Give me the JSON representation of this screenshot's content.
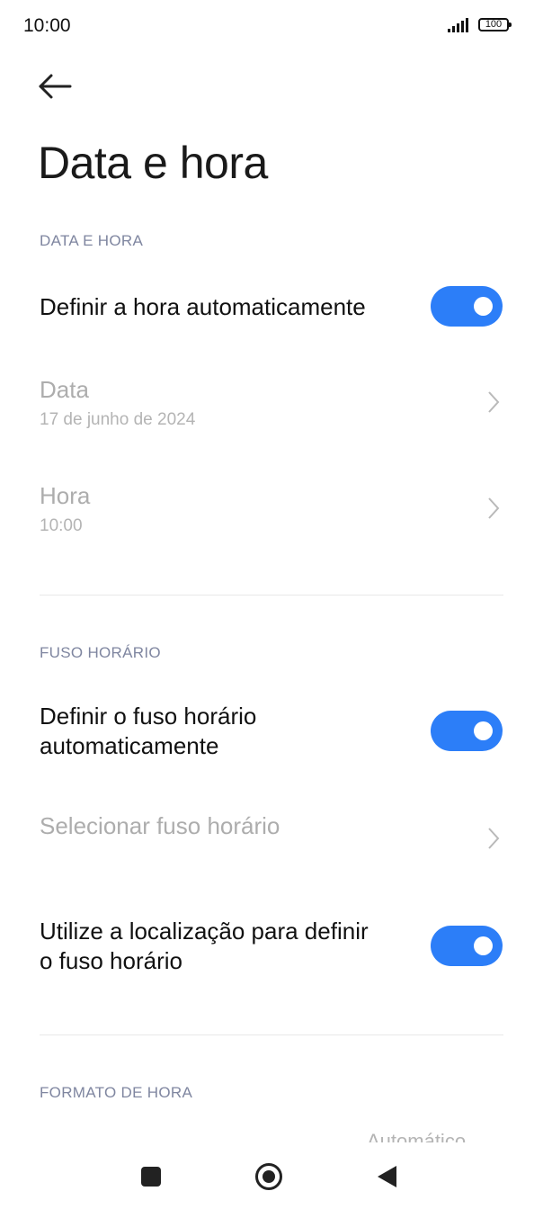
{
  "status": {
    "time": "10:00",
    "battery": "100",
    "signal_icon": "signal-icon",
    "battery_icon": "battery-icon"
  },
  "header": {
    "back_icon": "arrow-left-icon",
    "title": "Data e hora"
  },
  "sections": {
    "date_time": {
      "heading": "DATA E HORA",
      "auto_time": {
        "label": "Definir a hora automaticamente",
        "enabled": true
      },
      "date": {
        "label": "Data",
        "value": "17 de junho de 2024"
      },
      "time": {
        "label": "Hora",
        "value": "10:00"
      }
    },
    "timezone": {
      "heading": "FUSO HORÁRIO",
      "auto_timezone": {
        "label_line1": "Definir o fuso horário",
        "label_line2": "automaticamente",
        "enabled": true
      },
      "select_timezone": {
        "label": "Selecionar fuso horário"
      },
      "use_location": {
        "label_line1": "Utilize a localização para definir",
        "label_line2": "o fuso horário",
        "enabled": true
      }
    },
    "time_format": {
      "heading": "FORMATO DE HORA",
      "value": "Automático"
    }
  },
  "colors": {
    "accent": "#2c7ef8",
    "section_heading": "#7f86a0",
    "disabled_text": "#adadad"
  },
  "navbar": {
    "recents_icon": "square-icon",
    "home_icon": "circle-home-icon",
    "back_icon": "triangle-back-icon"
  }
}
